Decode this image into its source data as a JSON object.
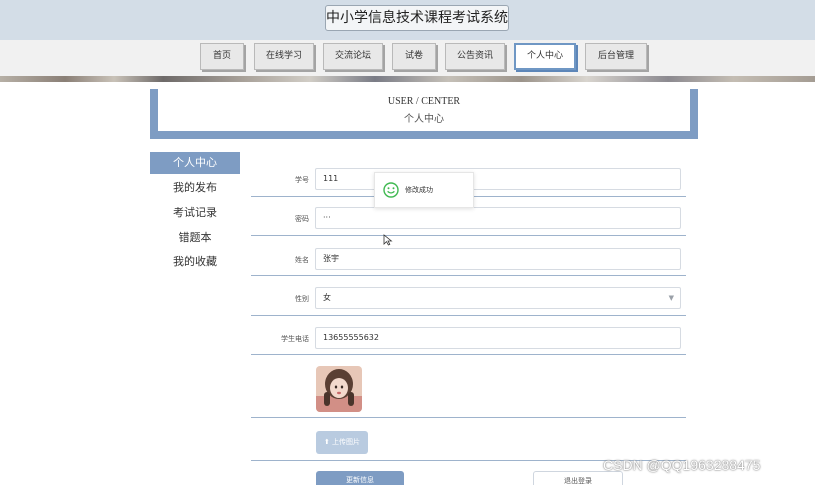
{
  "header": {
    "site_title": "中小学信息技术课程考试系统"
  },
  "nav": {
    "items": [
      {
        "label": "首页",
        "active": false
      },
      {
        "label": "在线学习",
        "active": false
      },
      {
        "label": "交流论坛",
        "active": false
      },
      {
        "label": "试卷",
        "active": false
      },
      {
        "label": "公告资讯",
        "active": false
      },
      {
        "label": "个人中心",
        "active": true
      },
      {
        "label": "后台管理",
        "active": false
      }
    ]
  },
  "center": {
    "title_en": "USER / CENTER",
    "title_cn": "个人中心"
  },
  "sidebar": {
    "items": [
      {
        "label": "个人中心",
        "active": true
      },
      {
        "label": "我的发布",
        "active": false
      },
      {
        "label": "考试记录",
        "active": false
      },
      {
        "label": "错题本",
        "active": false
      },
      {
        "label": "我的收藏",
        "active": false
      }
    ]
  },
  "form": {
    "student_id": {
      "label": "学号",
      "value": "111"
    },
    "password": {
      "label": "密码",
      "value": "···"
    },
    "name": {
      "label": "姓名",
      "value": "张宇"
    },
    "gender": {
      "label": "性别",
      "value": "女"
    },
    "phone": {
      "label": "学生电话",
      "value": "13655555632"
    },
    "upload_label": "上传图片",
    "update_label": "更新信息",
    "logout_label": "退出登录"
  },
  "toast": {
    "message": "修改成功"
  },
  "watermark": "CSDN @QQ1963288475",
  "colors": {
    "accent": "#7e9cc3",
    "header_bg": "#d3dde7",
    "success": "#3fb950"
  }
}
